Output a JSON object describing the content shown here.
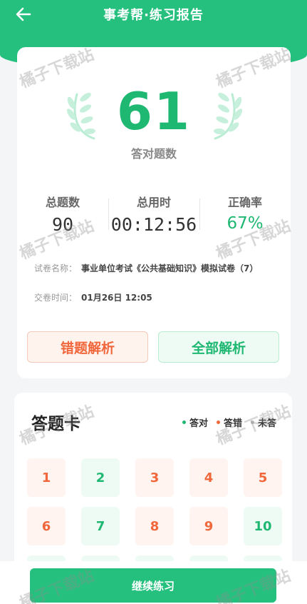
{
  "header": {
    "title": "事考帮·练习报告",
    "back_icon": "arrow-left-icon"
  },
  "result": {
    "score": "61",
    "score_label": "答对题数",
    "stats": [
      {
        "label": "总题数",
        "value": "90"
      },
      {
        "label": "总用时",
        "value": "00:12:56"
      },
      {
        "label": "正确率",
        "value": "67%"
      }
    ],
    "paper_label": "试卷名称：",
    "paper_name": "事业单位考试《公共基础知识》模拟试卷（7）",
    "submit_label": "交卷时间：",
    "submit_time": "01月26日  12:05",
    "wrong_analysis_label": "错题解析",
    "all_analysis_label": "全部解析"
  },
  "answer_sheet": {
    "title": "答题卡",
    "legend": [
      {
        "label": "答对",
        "color": "#1fb872"
      },
      {
        "label": "答错",
        "color": "#f0673c"
      },
      {
        "label": "未答",
        "color": "#bbbbbb"
      }
    ],
    "questions": [
      {
        "num": "1",
        "status": "wrong"
      },
      {
        "num": "2",
        "status": "right"
      },
      {
        "num": "3",
        "status": "wrong"
      },
      {
        "num": "4",
        "status": "wrong"
      },
      {
        "num": "5",
        "status": "wrong"
      },
      {
        "num": "6",
        "status": "wrong"
      },
      {
        "num": "7",
        "status": "right"
      },
      {
        "num": "8",
        "status": "wrong"
      },
      {
        "num": "9",
        "status": "wrong"
      },
      {
        "num": "10",
        "status": "right"
      }
    ]
  },
  "footer": {
    "continue_label": "继续练习"
  },
  "watermark": "橘子下载站",
  "colors": {
    "brand_green": "#26c07e",
    "correct": "#1fb872",
    "wrong": "#f0673c"
  }
}
